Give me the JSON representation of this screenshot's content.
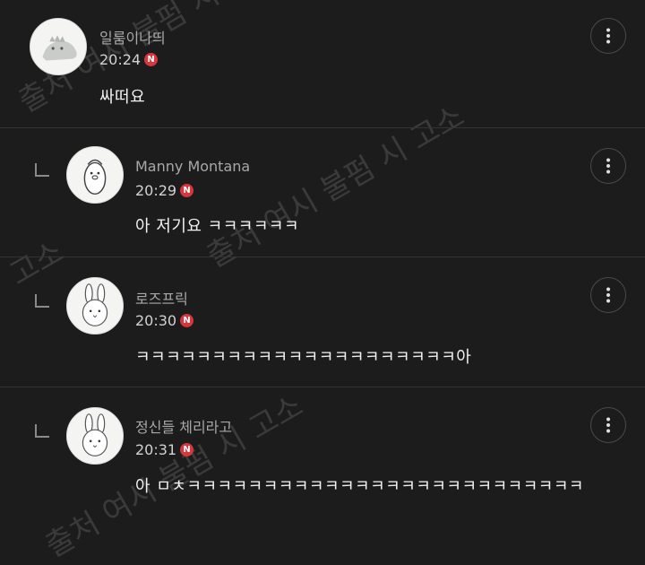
{
  "comments": [
    {
      "author": "일룸이나띄",
      "time": "20:24",
      "badge": "N",
      "text": "싸떠요",
      "is_reply": false,
      "avatar": "dinosaur-avatar"
    },
    {
      "author": "Manny Montana",
      "time": "20:29",
      "badge": "N",
      "text": "아 저기요 ㅋㅋㅋㅋㅋㅋ",
      "is_reply": true,
      "avatar": "bird-avatar"
    },
    {
      "author": "로즈프릭",
      "time": "20:30",
      "badge": "N",
      "text": "ㅋㅋㅋㅋㅋㅋㅋㅋㅋㅋㅋㅋㅋㅋㅋㅋㅋㅋㅋㅋㅋ아",
      "is_reply": true,
      "avatar": "bunny-avatar"
    },
    {
      "author": "정신들 체리라고",
      "time": "20:31",
      "badge": "N",
      "text": "아 ㅁㅊㅋㅋㅋㅋㅋㅋㅋㅋㅋㅋㅋㅋㅋㅋㅋㅋㅋㅋㅋㅋㅋㅋㅋㅋㅋㅋ",
      "is_reply": true,
      "avatar": "bunny-avatar"
    }
  ],
  "watermark": {
    "text_1": "출처 여시 불펌 시 고소",
    "text_2": "출처 여시 불펌 시 고소",
    "text_3": "고소",
    "text_4": "출처 여시 불펌 시 고소"
  },
  "colors": {
    "background": "#1c1c1d",
    "badge": "#d8353c",
    "divider": "#333335"
  }
}
